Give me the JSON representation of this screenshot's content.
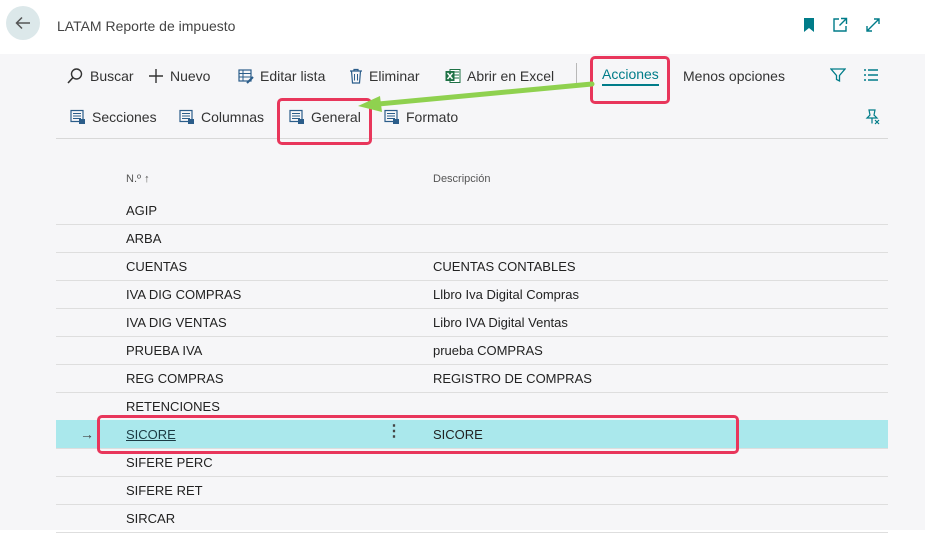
{
  "header": {
    "title": "LATAM Reporte de impuesto"
  },
  "actions": {
    "buscar": "Buscar",
    "nuevo": "Nuevo",
    "editar_lista": "Editar lista",
    "eliminar": "Eliminar",
    "abrir_excel": "Abrir en Excel",
    "acciones": "Acciones",
    "menos_opciones": "Menos opciones"
  },
  "subactions": {
    "secciones": "Secciones",
    "columnas": "Columnas",
    "general": "General",
    "formato": "Formato"
  },
  "table": {
    "headers": {
      "no": "N.º ↑",
      "descripcion": "Descripción"
    },
    "rows": [
      {
        "no": "AGIP",
        "descripcion": ""
      },
      {
        "no": "ARBA",
        "descripcion": ""
      },
      {
        "no": "CUENTAS",
        "descripcion": "CUENTAS CONTABLES"
      },
      {
        "no": "IVA DIG COMPRAS",
        "descripcion": "Llbro Iva Digital Compras"
      },
      {
        "no": "IVA DIG VENTAS",
        "descripcion": "Libro IVA Digital Ventas"
      },
      {
        "no": "PRUEBA IVA",
        "descripcion": "prueba COMPRAS"
      },
      {
        "no": "REG COMPRAS",
        "descripcion": "REGISTRO DE COMPRAS"
      },
      {
        "no": "RETENCIONES",
        "descripcion": ""
      },
      {
        "no": "SICORE",
        "descripcion": "SICORE"
      },
      {
        "no": "SIFERE PERC",
        "descripcion": ""
      },
      {
        "no": "SIFERE RET",
        "descripcion": ""
      },
      {
        "no": "SIRCAR",
        "descripcion": ""
      }
    ],
    "selected_row": "SICORE"
  },
  "colors": {
    "accent": "#007c89",
    "selected_row": "#aae8ec",
    "highlight_box": "#e8365b",
    "arrow": "#8fd14f",
    "excel_green": "#1e7145"
  },
  "icons": [
    "back-arrow-icon",
    "bookmark-icon",
    "open-new-window-icon",
    "expand-icon",
    "search-icon",
    "plus-icon",
    "edit-list-icon",
    "trash-icon",
    "excel-icon",
    "filter-icon",
    "list-view-icon",
    "sections-icon",
    "columns-icon",
    "general-icon",
    "format-icon",
    "personalize-icon",
    "row-arrow-icon",
    "row-menu-icon"
  ]
}
